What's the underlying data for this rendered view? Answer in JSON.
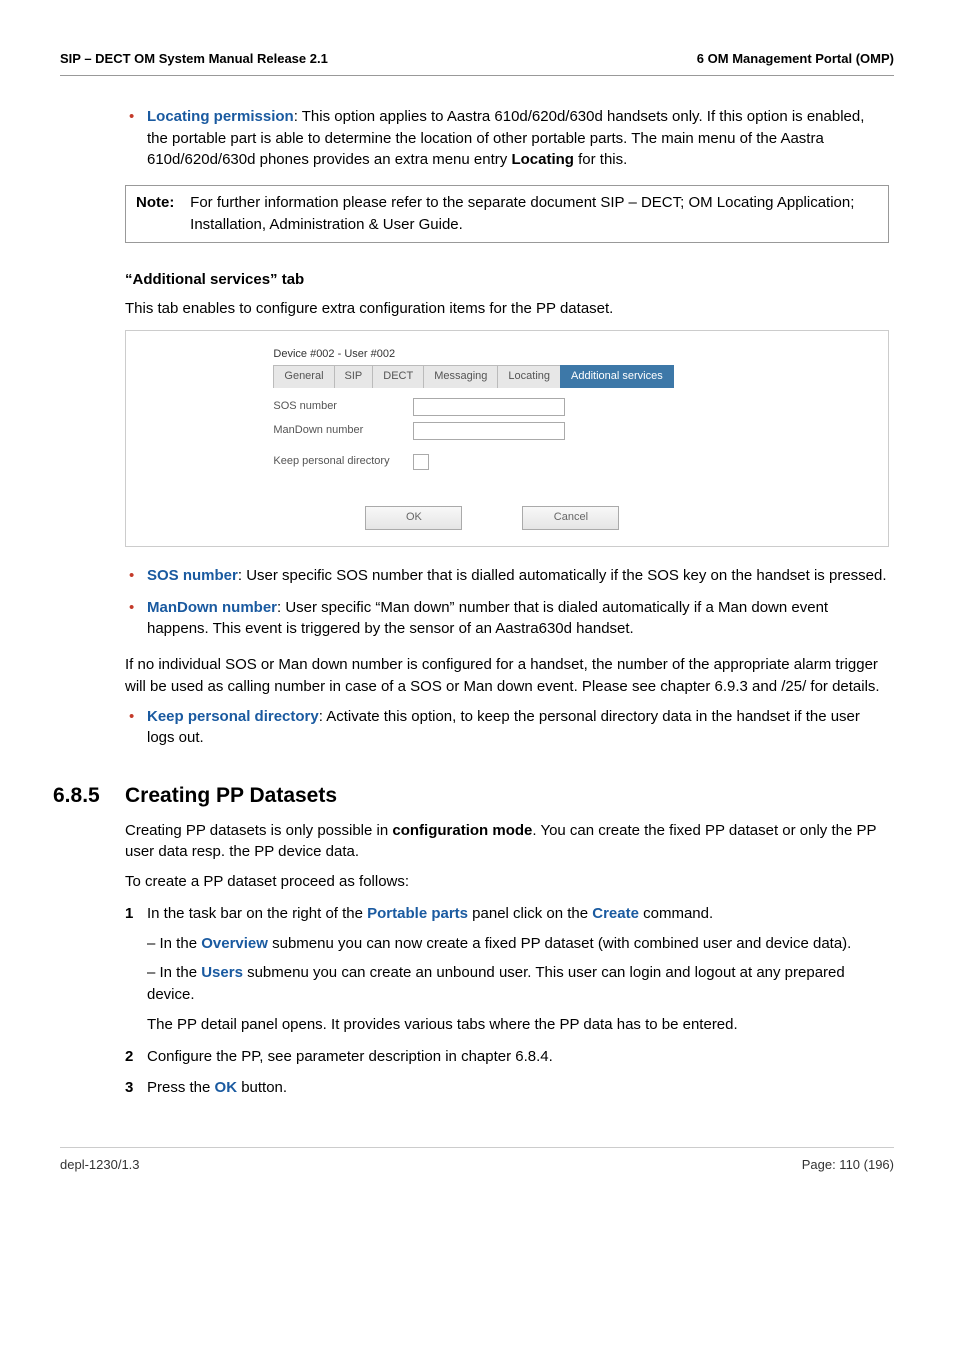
{
  "header": {
    "left": "SIP – DECT OM System Manual Release 2.1",
    "right": "6 OM Management Portal (OMP)"
  },
  "topBullet": {
    "lead": "Locating permission",
    "rest": ": This option applies to Aastra 610d/620d/630d handsets only. If this option is enabled, the portable part is able to determine the location of other portable parts. The main menu of the Aastra 610d/620d/630d phones provides an extra menu entry ",
    "boldWord": "Locating",
    "tail": " for this."
  },
  "note": {
    "label": "Note:",
    "text": "For further information please refer to the separate document SIP – DECT; OM Locating Application; Installation, Administration & User Guide."
  },
  "additional": {
    "heading": "“Additional services” tab",
    "intro": "This tab enables to configure extra configuration items for the PP dataset."
  },
  "dialog": {
    "title": "Device #002 - User #002",
    "tabs": [
      "General",
      "SIP",
      "DECT",
      "Messaging",
      "Locating",
      "Additional services"
    ],
    "fields": {
      "sos": "SOS number",
      "mandown": "ManDown number",
      "keep": "Keep personal directory"
    },
    "buttons": {
      "ok": "OK",
      "cancel": "Cancel"
    }
  },
  "bullets2": {
    "sos_lead": "SOS number",
    "sos_rest": ": User specific SOS number that is dialled automatically if the SOS key on the handset is pressed.",
    "mandown_lead": "ManDown number",
    "mandown_rest": ": User specific “Man down” number that is dialed automatically if a Man down event happens. This event is triggered by the sensor of an Aastra630d handset."
  },
  "midPara": "If no individual SOS or Man down number is configured for a handset, the number of the appropriate alarm trigger will be used as calling number in case of a SOS or Man down event. Please see chapter 6.9.3 and /25/ for details.",
  "bullets3": {
    "keep_lead": "Keep personal directory",
    "keep_rest": ": Activate this option, to keep the personal directory data in the handset if the user logs out."
  },
  "section": {
    "num": "6.8.5",
    "title": "Creating PP Datasets"
  },
  "secP1_a": "Creating PP datasets is only possible in ",
  "secP1_bold": "configuration mode",
  "secP1_b": ". You can create the fixed PP dataset or only the PP user data resp. the PP device data.",
  "secP2": "To create a PP dataset proceed as follows:",
  "steps": {
    "s1_a": "In the task bar on the right of the ",
    "s1_pp": "Portable parts",
    "s1_b": " panel click on the ",
    "s1_create": "Create",
    "s1_c": " command.",
    "s1_sub1_a": "– In the ",
    "s1_sub1_ov": "Overview",
    "s1_sub1_b": " submenu you can now create a fixed PP dataset (with combined user and device data).",
    "s1_sub2_a": "– In the ",
    "s1_sub2_us": "Users",
    "s1_sub2_b": " submenu you can create an unbound user. This user can login and logout at any prepared device.",
    "s1_sub3": "The PP detail panel opens. It provides various tabs where the PP data has to be entered.",
    "s2": "Configure the PP, see parameter description in chapter 6.8.4.",
    "s3_a": "Press the ",
    "s3_ok": "OK",
    "s3_b": " button."
  },
  "footer": {
    "left": "depl-1230/1.3",
    "right": "Page: 110 (196)"
  }
}
